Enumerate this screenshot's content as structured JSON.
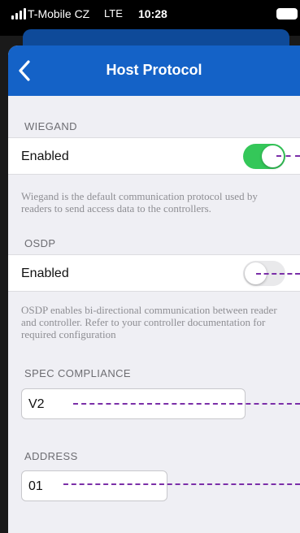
{
  "status_bar": {
    "carrier": "T-Mobile CZ",
    "network": "LTE",
    "time": "10:28"
  },
  "navbar": {
    "title": "Host Protocol",
    "back_icon": "chevron-left-icon"
  },
  "wiegand": {
    "header": "WIEGAND",
    "enabled_label": "Enabled",
    "enabled": true,
    "footer": "Wiegand is the default communication protocol used by readers to send access data to the controllers."
  },
  "osdp": {
    "header": "OSDP",
    "enabled_label": "Enabled",
    "enabled": false,
    "footer": "OSDP enables bi-directional communication between reader and controller. Refer to your controller documentation for required configuration"
  },
  "spec_compliance": {
    "header": "SPEC COMPLIANCE",
    "value": "V2"
  },
  "address": {
    "header": "ADDRESS",
    "value": "01"
  },
  "colors": {
    "navbar": "#1462c7",
    "toggle_on": "#34c759",
    "annotation": "#7b2fa8"
  }
}
